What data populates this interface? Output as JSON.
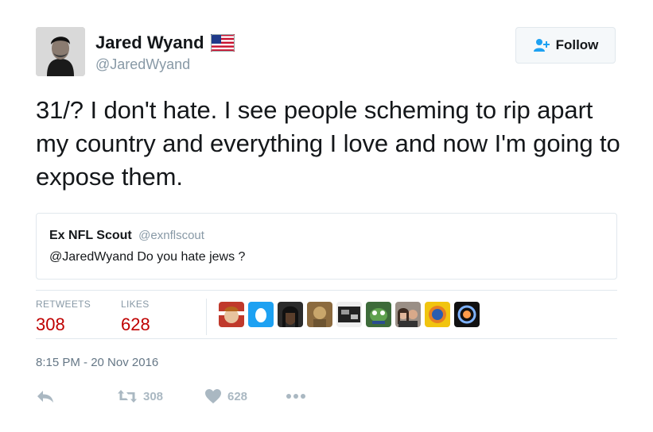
{
  "author": {
    "display_name": "Jared Wyand",
    "handle": "@JaredWyand",
    "flag_icon": "us-flag-icon"
  },
  "follow_button": {
    "label": "Follow",
    "icon": "add-user-icon"
  },
  "tweet": {
    "text": "31/? I don't hate. I see people scheming to rip apart my country and everything I love and now I'm going to expose them."
  },
  "quoted_tweet": {
    "name": "Ex NFL Scout",
    "handle": "@exnflscout",
    "text": "@JaredWyand Do you hate jews ?"
  },
  "stats": {
    "retweets_label": "RETWEETS",
    "retweets": "308",
    "likes_label": "LIKES",
    "likes": "628"
  },
  "likers": [
    "liker-avatar-1",
    "liker-avatar-2",
    "liker-avatar-3",
    "liker-avatar-4",
    "liker-avatar-5",
    "liker-avatar-6",
    "liker-avatar-7",
    "liker-avatar-8",
    "liker-avatar-9"
  ],
  "timestamp": "8:15 PM - 20 Nov 2016",
  "actions": {
    "reply_icon": "reply-icon",
    "retweet_icon": "retweet-icon",
    "retweet_count": "308",
    "like_icon": "heart-icon",
    "like_count": "628",
    "more_icon": "more-icon"
  },
  "colors": {
    "stat_value": "#bf0000",
    "muted": "#8899a6",
    "border": "#e1e8ed",
    "action_icon": "#aab8c2"
  }
}
